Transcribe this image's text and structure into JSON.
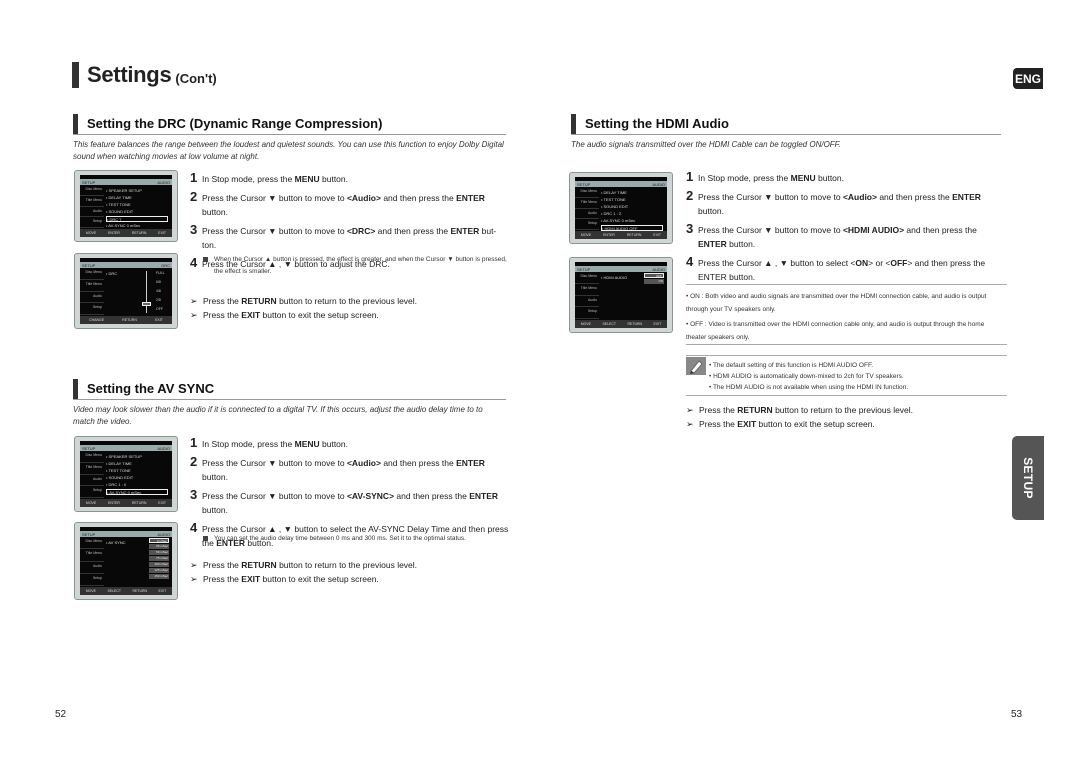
{
  "page": {
    "title": "Settings",
    "title_suffix": "(Con't)",
    "lang_badge": "ENG",
    "side_tab": "SETUP",
    "page_left": "52",
    "page_right": "53"
  },
  "drc": {
    "heading": "Setting the DRC (Dynamic Range Compression)",
    "intro": "This feature balances the range between the loudest and quietest sounds. You can use this function to enjoy Dolby Digital sound when watching movies at low volume at night.",
    "steps": [
      {
        "num": "1",
        "pre": "In Stop mode, press the ",
        "b1": "MENU",
        "mid": " button.",
        "b2": "",
        "post": ""
      },
      {
        "num": "2",
        "pre": "Press the Cursor ▼ button to move to ",
        "b1": "<Audio>",
        "mid": " and then press the ",
        "b2": "ENTER",
        "post": " button."
      },
      {
        "num": "3",
        "pre": "Press the Cursor ▼ button to move to ",
        "b1": "<DRC>",
        "mid": " and then press the ",
        "b2": "ENTER",
        "post": " but-ton."
      },
      {
        "num": "4",
        "pre": "Press the Cursor ▲ , ▼ button to adjust the DRC.",
        "b1": "",
        "mid": "",
        "b2": "",
        "post": ""
      }
    ],
    "note": "When the Cursor ▲ button is pressed, the effect is greater, and when the Cursor ▼ button is pressed, the effect is smaller.",
    "tips": [
      {
        "pre": "Press the ",
        "b": "RETURN",
        "post": " button to return to the previous level."
      },
      {
        "pre": "Press the ",
        "b": "EXIT",
        "post": " button to exit the setup screen."
      }
    ],
    "screen1": {
      "left": "SETUP",
      "right": "AUDIO",
      "side": [
        "Disc Menu",
        "Title Menu",
        "Audio",
        "Setup"
      ],
      "rows": [
        "• SPEAKER SETUP",
        "• DELAY TIME",
        "• TEST TONE",
        "• SOUND EDIT",
        "• DRC        7",
        "• AV-SYNC     0 mSec"
      ],
      "bottom": [
        "MOVE",
        "ENTER",
        "RETURN",
        "EXIT"
      ]
    },
    "screen2": {
      "left": "SETUP",
      "right": "DRC",
      "side": [
        "Disc Menu",
        "Title Menu",
        "Audio",
        "Setup"
      ],
      "rows": [
        "• DRC"
      ],
      "levels": [
        "FULL",
        "6/8",
        "4/8",
        "2/8",
        "OFF"
      ],
      "bottom": [
        "CHANGE",
        "RETURN",
        "EXIT"
      ]
    }
  },
  "avsync": {
    "heading": "Setting the AV SYNC",
    "intro": "Video may look slower than the audio if it is connected to a digital TV. If this occurs, adjust the audio delay time to to match the video.",
    "steps": [
      {
        "num": "1",
        "pre": "In Stop mode, press the ",
        "b1": "MENU",
        "mid": " button.",
        "b2": "",
        "post": ""
      },
      {
        "num": "2",
        "pre": "Press the Cursor ▼ button to move to ",
        "b1": "<Audio>",
        "mid": " and then press the ",
        "b2": "ENTER",
        "post": " button."
      },
      {
        "num": "3",
        "pre": "Press the Cursor ▼ button to move to ",
        "b1": "<AV-SYNC>",
        "mid": " and then press the ",
        "b2": "ENTER",
        "post": " button."
      },
      {
        "num": "4",
        "pre": "Press the Cursor ▲ , ▼ button to select the AV-SYNC Delay Time  and then press the ",
        "b1": "ENTER",
        "mid": " button.",
        "b2": "",
        "post": ""
      }
    ],
    "note": "You can set the audio delay time between 0 ms and 300 ms. Set it to the optimal status.",
    "tips": [
      {
        "pre": "Press the ",
        "b": "RETURN",
        "post": " button to return to the previous level."
      },
      {
        "pre": "Press the ",
        "b": "EXIT",
        "post": " button to exit the setup screen."
      }
    ],
    "screen1": {
      "left": "SETUP",
      "right": "AUDIO",
      "side": [
        "Disc Menu",
        "Title Menu",
        "Audio",
        "Setup"
      ],
      "rows": [
        "• SPEAKER SETUP",
        "• DELAY TIME",
        "• TEST TONE",
        "• SOUND EDIT",
        "• DRC        1 : 0",
        "• AV-SYNC     0 mSec"
      ],
      "bottom": [
        "MOVE",
        "ENTER",
        "RETURN",
        "EXIT"
      ]
    },
    "screen2": {
      "left": "SETUP",
      "right": "AUDIO",
      "side": [
        "Disc Menu",
        "Title Menu",
        "Audio",
        "Setup"
      ],
      "rows": [
        "• AV SYNC"
      ],
      "options": [
        "0 mSec",
        "25 mSec",
        "50 mSec",
        "75 mSec",
        "100 mSec",
        "125 mSec",
        "150 mSec"
      ],
      "bottom": [
        "MOVE",
        "SELECT",
        "RETURN",
        "EXIT"
      ]
    }
  },
  "hdmi": {
    "heading": "Setting the HDMI Audio",
    "intro": "The audio signals transmitted over the HDMI Cable can be toggled ON/OFF.",
    "steps": [
      {
        "num": "1",
        "pre": "In Stop mode, press the ",
        "b1": "MENU",
        "mid": " button.",
        "b2": "",
        "post": ""
      },
      {
        "num": "2",
        "pre": "Press the Cursor ▼ button to move to ",
        "b1": "<Audio>",
        "mid": " and then press the ",
        "b2": "ENTER",
        "post": " button."
      },
      {
        "num": "3",
        "pre": "Press the Cursor ▼ button to move to ",
        "b1": "<HDMI AUDIO>",
        "mid": " and then press the ",
        "b2": "ENTER",
        "post": " button."
      },
      {
        "num": "4",
        "pre": "Press the Cursor ▲ , ▼ button to select <",
        "b1": "ON",
        "mid": "> or <",
        "b2": "OFF",
        "post": "> and then press the ENTER button."
      }
    ],
    "bullets": [
      "• ON : Both video and audio signals are transmitted over the HDMI connection cable, and audio is output through your TV speakers only.",
      "• OFF : Video is transmitted over the HDMI connection cable only, and audio is output through the home theater speakers only."
    ],
    "notes": [
      "• The default setting of this function is HDMI AUDIO OFF.",
      "• HDMI AUDIO is automatically down-mixed to 2ch for TV speakers.",
      "• The HDMI AUDIO is not available when using the HDMI IN function."
    ],
    "tips": [
      {
        "pre": "Press the ",
        "b": "RETURN",
        "post": " button to return to the previous level."
      },
      {
        "pre": "Press the ",
        "b": "EXIT",
        "post": " button to exit the setup screen."
      }
    ],
    "screen1": {
      "left": "SETUP",
      "right": "AUDIO",
      "side": [
        "Disc Menu",
        "Title Menu",
        "Audio",
        "Setup"
      ],
      "rows": [
        "• DELAY TIME",
        "• TEST TONE",
        "• SOUND EDIT",
        "• DRC        1 : 2",
        "• AV-SYNC     0 mSec",
        "• HDMI AUDIO   OFF"
      ],
      "bottom": [
        "MOVE",
        "ENTER",
        "RETURN",
        "EXIT"
      ]
    },
    "screen2": {
      "left": "SETUP",
      "right": "AUDIO",
      "side": [
        "Disc Menu",
        "Title Menu",
        "Audio",
        "Setup"
      ],
      "rows": [
        "• HDMI AUDIO"
      ],
      "options": [
        "OFF",
        "ON"
      ],
      "bottom": [
        "MOVE",
        "SELECT",
        "RETURN",
        "EXIT"
      ]
    }
  }
}
